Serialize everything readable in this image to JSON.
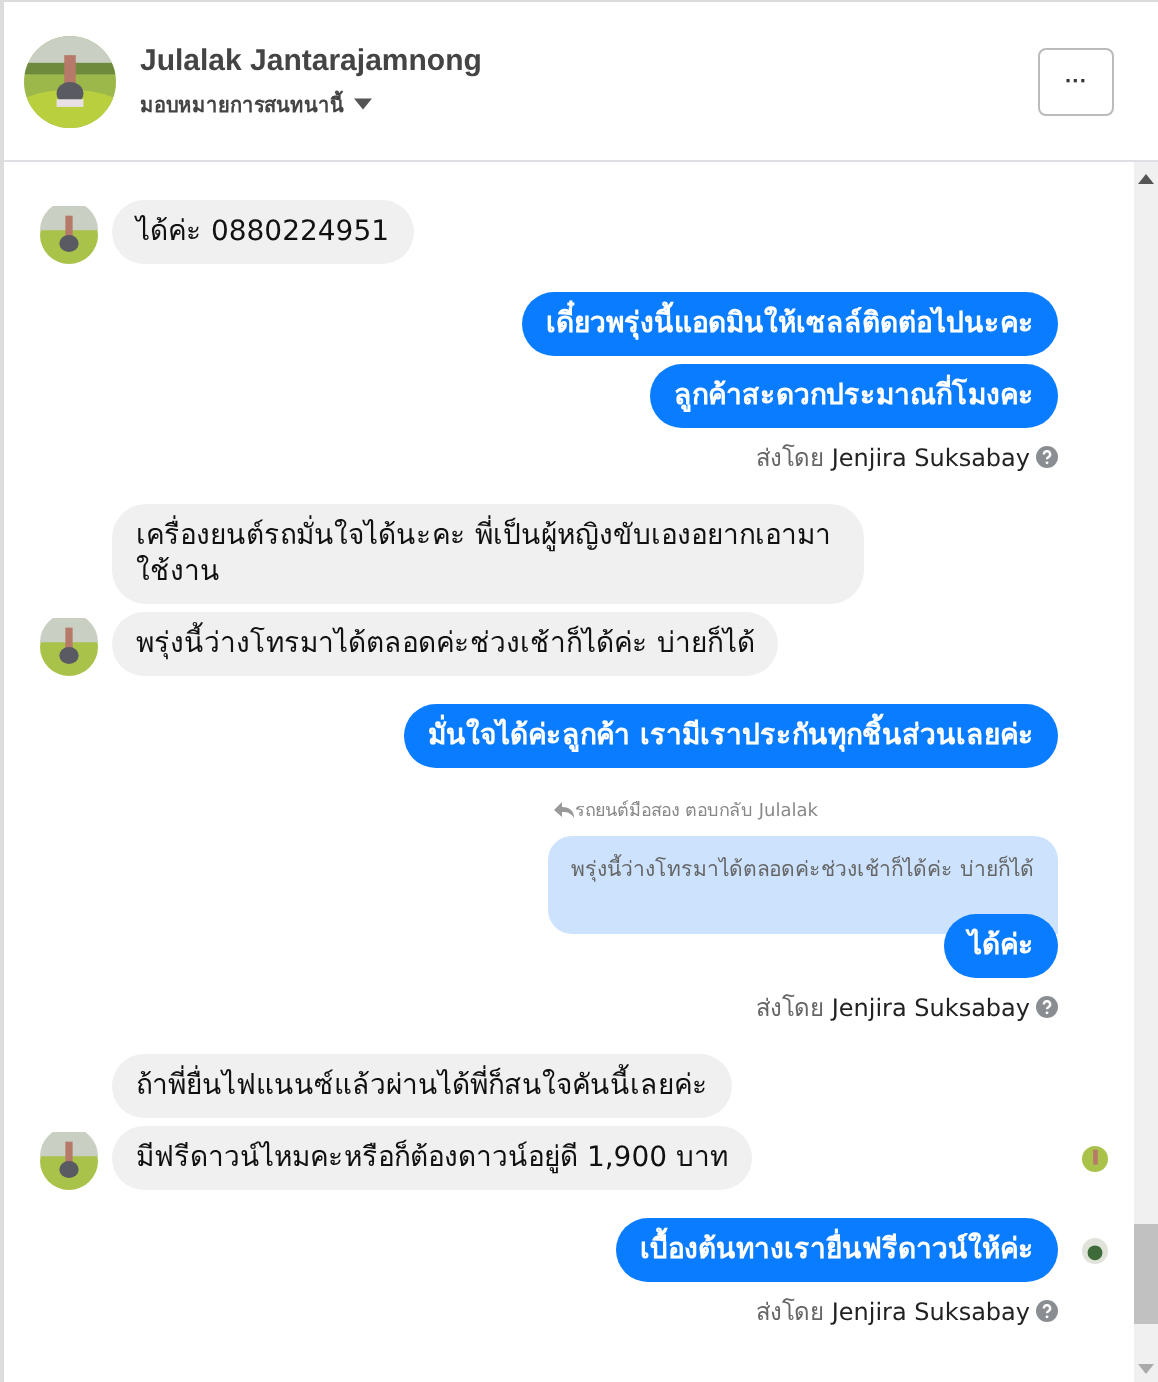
{
  "header": {
    "name": "Julalak Jantarajamnong",
    "subtitle": "มอบหมายการสนทนานี้",
    "more_button": "···"
  },
  "messages": [
    {
      "kind": "in",
      "text": "ได้ค่ะ  0880224951",
      "avatar": true,
      "seen": false
    },
    {
      "kind": "out",
      "text": "เดี๋ยวพรุ่งนี้แอดมินให้เซลล์ติดต่อไปนะคะ",
      "seen": false
    },
    {
      "kind": "out",
      "text": "ลูกค้าสะดวกประมาณกี่โมงคะ",
      "seen": false
    },
    {
      "kind": "sent_by",
      "prefix": "ส่งโดย",
      "name": "Jenjira Suksabay"
    },
    {
      "kind": "in",
      "text": "เครื่องยนต์รถมั่นใจได้นะคะ พี่เป็นผู้หญิงขับเองอยากเอามาใช้งาน",
      "avatar": false,
      "seen": false
    },
    {
      "kind": "in",
      "text": "พรุ่งนี้ว่างโทรมาได้ตลอดค่ะช่วงเช้าก็ได้ค่ะ บ่ายก็ได้",
      "avatar": true,
      "seen": false
    },
    {
      "kind": "out",
      "text": "มั่นใจได้ค่ะลูกค้า เรามีเราประกันทุกชิ้นส่วนเลยค่ะ",
      "seen": false
    },
    {
      "kind": "reply",
      "label": "รถยนต์มือสอง ตอบกลับ Julalak",
      "quote": "พรุ่งนี้ว่างโทรมาได้ตลอดค่ะช่วงเช้าก็ได้ค่ะ บ่ายก็ได้",
      "text": "ได้ค่ะ"
    },
    {
      "kind": "sent_by",
      "prefix": "ส่งโดย",
      "name": "Jenjira Suksabay"
    },
    {
      "kind": "in",
      "text": "ถ้าพี่ยื่นไฟแนนซ์แล้วผ่านได้พี่ก็สนใจคันนี้เลยค่ะ",
      "avatar": false,
      "seen": false
    },
    {
      "kind": "in",
      "text": "มีฟรีดาวน์ไหมคะหรือก็ต้องดาวน์อยู่ดี 1,900 บาท",
      "avatar": true,
      "seen": true
    },
    {
      "kind": "out",
      "text": "เบื้องต้นทางเรายื่นฟรีดาวน์ให้ค่ะ",
      "seen": true
    },
    {
      "kind": "sent_by",
      "prefix": "ส่งโดย",
      "name": "Jenjira Suksabay"
    }
  ]
}
